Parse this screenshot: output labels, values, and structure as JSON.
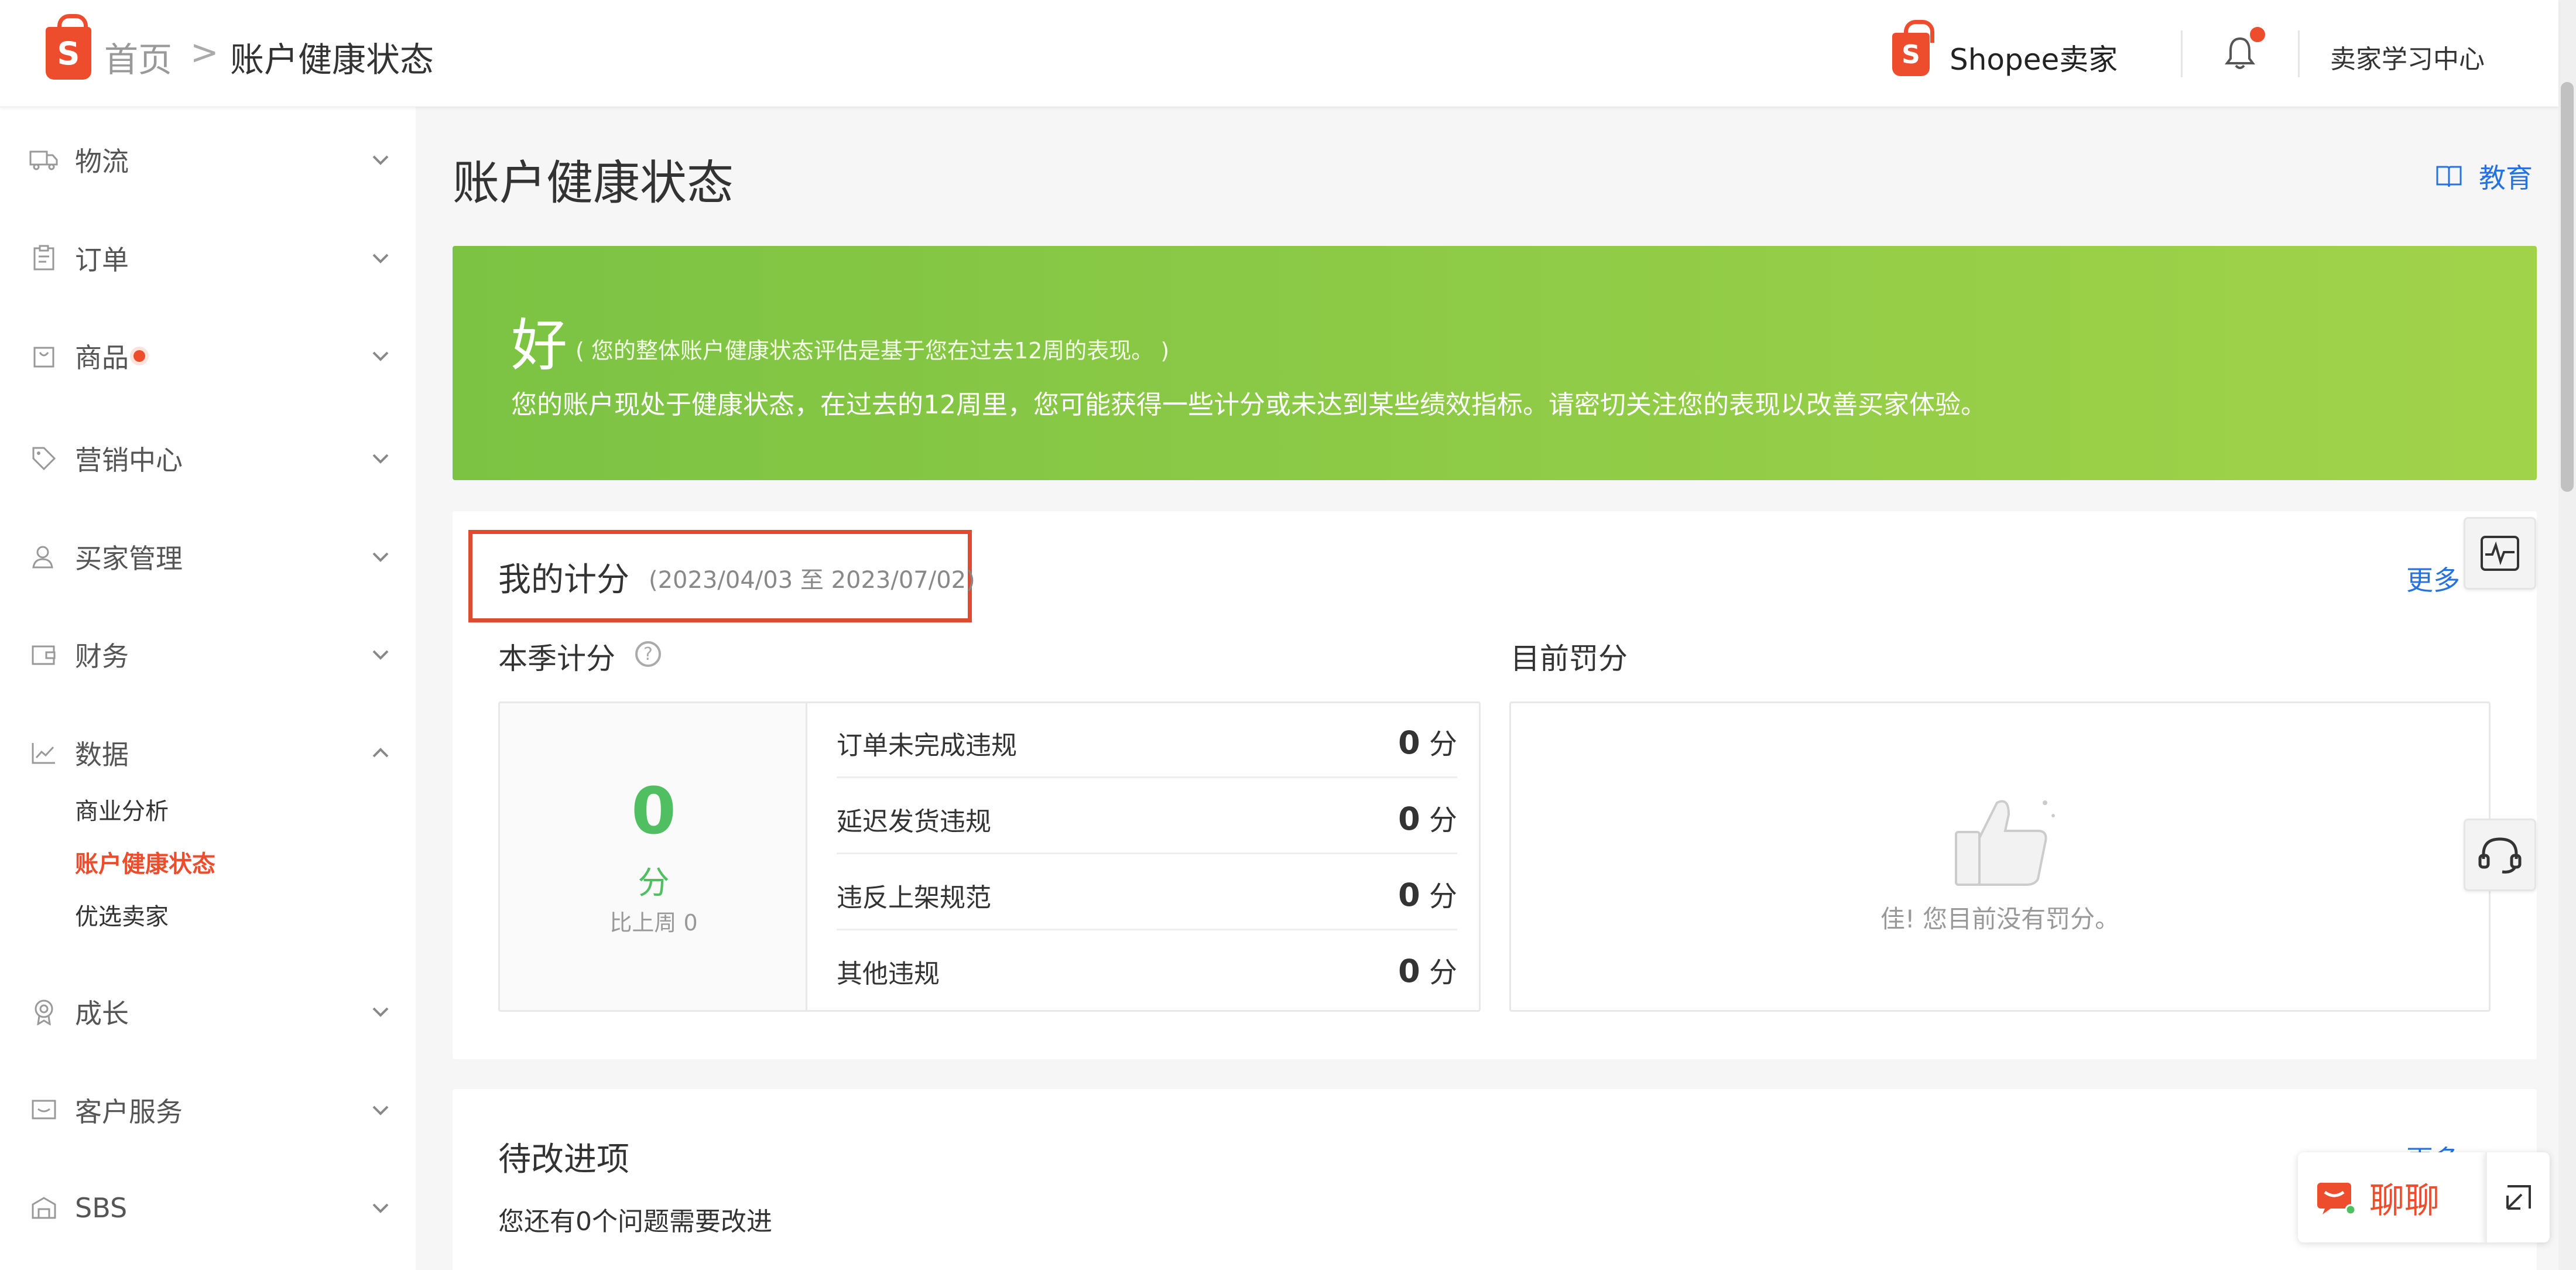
{
  "header": {
    "breadcrumb_home": "首页",
    "breadcrumb_sep": ">",
    "breadcrumb_current": "账户健康状态",
    "brand": "Shopee卖家",
    "logo_letter": "S",
    "learning_center": "卖家学习中心",
    "accent_color": "#ee4d2d"
  },
  "sidebar": {
    "items": [
      {
        "label": "物流",
        "icon": "truck-icon",
        "expanded": false
      },
      {
        "label": "订单",
        "icon": "clipboard-icon",
        "expanded": false
      },
      {
        "label": "商品",
        "icon": "bag-icon",
        "expanded": false,
        "badge_dot": true
      },
      {
        "label": "营销中心",
        "icon": "tag-icon",
        "expanded": false
      },
      {
        "label": "买家管理",
        "icon": "user-icon",
        "expanded": false
      },
      {
        "label": "财务",
        "icon": "wallet-icon",
        "expanded": false
      },
      {
        "label": "数据",
        "icon": "chart-icon",
        "expanded": true
      },
      {
        "label": "成长",
        "icon": "medal-icon",
        "expanded": false
      },
      {
        "label": "客户服务",
        "icon": "chat-box-icon",
        "expanded": false
      },
      {
        "label": "SBS",
        "icon": "warehouse-icon",
        "expanded": false
      }
    ],
    "data_subitems": [
      "商业分析",
      "账户健康状态",
      "优选卖家"
    ]
  },
  "main": {
    "title": "账户健康状态",
    "education_link": "教育",
    "banner": {
      "status": "好",
      "note": "( 您的整体账户健康状态评估是基于您在过去12周的表现。 )",
      "message": "您的账户现处于健康状态，在过去的12周里，您可能获得一些计分或未达到某些绩效指标。请密切关注您的表现以改善买家体验。"
    },
    "my_points": {
      "title": "我的计分",
      "date_range": "(2023/04/03 至 2023/07/02)",
      "more": "更多",
      "season_label": "本季计分",
      "score": "0",
      "score_unit": "分",
      "compare": "比上周 0",
      "violations": [
        {
          "name": "订单未完成违规",
          "value": "0",
          "unit": "分"
        },
        {
          "name": "延迟发货违规",
          "value": "0",
          "unit": "分"
        },
        {
          "name": "违反上架规范",
          "value": "0",
          "unit": "分"
        },
        {
          "name": "其他违规",
          "value": "0",
          "unit": "分"
        }
      ],
      "penalty_label": "目前罚分",
      "penalty_empty": "佳! 您目前没有罚分。"
    },
    "improve": {
      "title": "待改进项",
      "more": "更多 >",
      "subtitle": "您还有0个问题需要改进"
    }
  },
  "chat": {
    "label": "聊聊"
  }
}
